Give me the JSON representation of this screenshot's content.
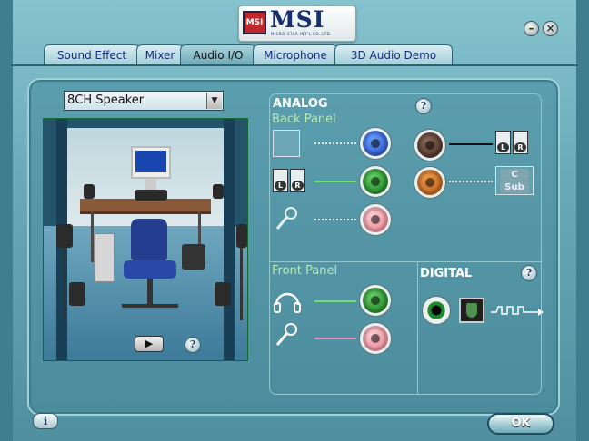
{
  "header": {
    "brand": "MSI",
    "brand_sub": "MICRO-STAR INT'L CO.,LTD.",
    "emblem_text": "MSI"
  },
  "window_controls": {
    "minimize": "–",
    "close": "×"
  },
  "tabs": [
    {
      "label": "Sound Effect",
      "active": false
    },
    {
      "label": "Mixer",
      "active": false
    },
    {
      "label": "Audio I/O",
      "active": true
    },
    {
      "label": "Microphone",
      "active": false
    },
    {
      "label": "3D Audio Demo",
      "active": false
    }
  ],
  "speaker_config": {
    "selected": "8CH Speaker"
  },
  "analog": {
    "title": "ANALOG",
    "back_panel": "Back Panel",
    "front_panel": "Front Panel",
    "jacks": {
      "blue": "#1640b8",
      "green": "#0d6c14",
      "pink": "#d86f80",
      "brown": "#3a2216",
      "orange": "#a64e10"
    },
    "lr_left": "L",
    "lr_right": "R",
    "center_label": "C",
    "sub_label": "Sub"
  },
  "digital": {
    "title": "DIGITAL"
  },
  "icons": {
    "info": "i",
    "play": "▶",
    "help": "?"
  },
  "footer": {
    "ok_label": "OK"
  }
}
